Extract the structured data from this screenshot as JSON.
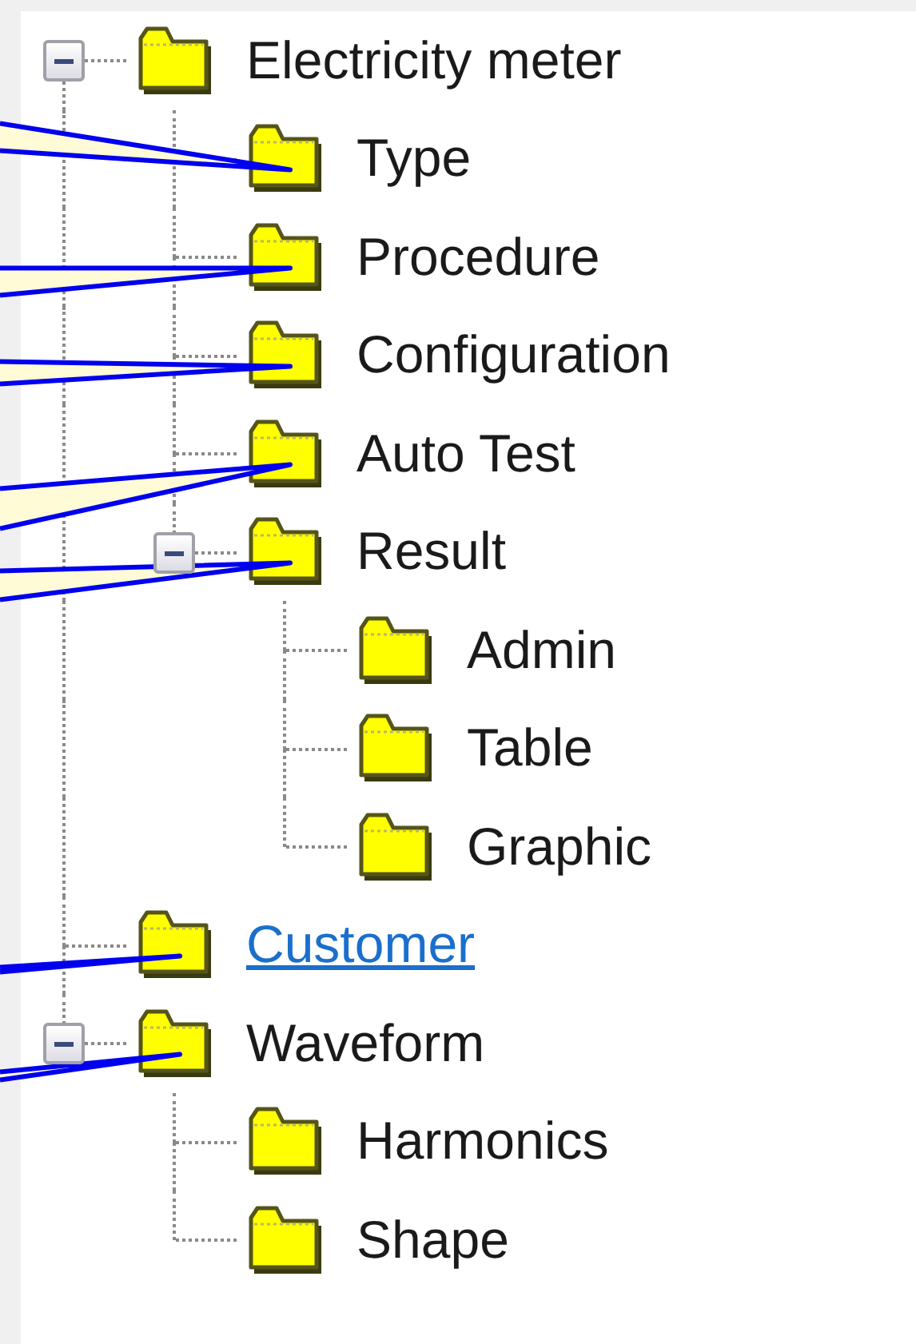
{
  "tree": [
    {
      "label": "Electricity meter",
      "expanded": true,
      "hovered": false,
      "callout": false,
      "children": [
        {
          "label": "Type",
          "hovered": false,
          "callout": true
        },
        {
          "label": "Procedure",
          "hovered": false,
          "callout": true
        },
        {
          "label": "Configuration",
          "hovered": false,
          "callout": true
        },
        {
          "label": "Auto Test",
          "hovered": false,
          "callout": true
        },
        {
          "label": "Result",
          "expanded": true,
          "hovered": false,
          "callout": true,
          "children": [
            {
              "label": "Admin",
              "hovered": false,
              "callout": false
            },
            {
              "label": "Table",
              "hovered": false,
              "callout": false
            },
            {
              "label": "Graphic",
              "hovered": false,
              "callout": false
            }
          ]
        }
      ]
    },
    {
      "label": "Customer",
      "hovered": true,
      "callout": true
    },
    {
      "label": "Waveform",
      "expanded": true,
      "hovered": false,
      "callout": true,
      "children": [
        {
          "label": "Harmonics",
          "hovered": false,
          "callout": false
        },
        {
          "label": "Shape",
          "hovered": false,
          "callout": false
        }
      ]
    }
  ]
}
